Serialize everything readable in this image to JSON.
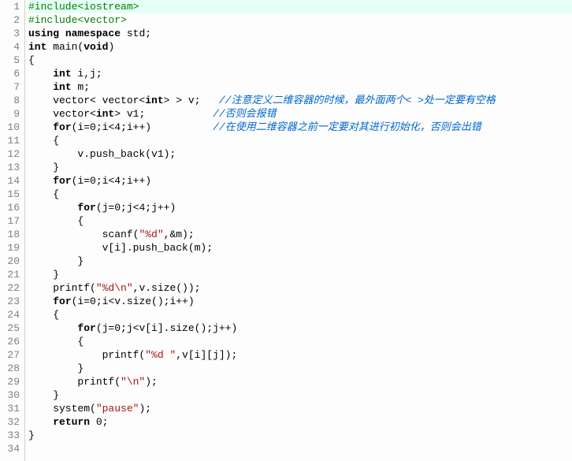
{
  "lines": [
    {
      "n": 1,
      "hl": true,
      "segs": [
        {
          "c": "pp",
          "t": "#include<iostream>"
        }
      ]
    },
    {
      "n": 2,
      "segs": [
        {
          "c": "pp",
          "t": "#include<vector>"
        }
      ]
    },
    {
      "n": 3,
      "segs": [
        {
          "c": "kw",
          "t": "using"
        },
        {
          "c": "txt",
          "t": " "
        },
        {
          "c": "kw",
          "t": "namespace"
        },
        {
          "c": "txt",
          "t": " std;"
        }
      ]
    },
    {
      "n": 4,
      "segs": [
        {
          "c": "kw",
          "t": "int"
        },
        {
          "c": "txt",
          "t": " main("
        },
        {
          "c": "kw",
          "t": "void"
        },
        {
          "c": "txt",
          "t": ")"
        }
      ]
    },
    {
      "n": 5,
      "segs": [
        {
          "c": "txt",
          "t": "{"
        }
      ]
    },
    {
      "n": 6,
      "segs": [
        {
          "c": "txt",
          "t": "    "
        },
        {
          "c": "kw",
          "t": "int"
        },
        {
          "c": "txt",
          "t": " i,j;"
        }
      ]
    },
    {
      "n": 7,
      "segs": [
        {
          "c": "txt",
          "t": "    "
        },
        {
          "c": "kw",
          "t": "int"
        },
        {
          "c": "txt",
          "t": " m;"
        }
      ]
    },
    {
      "n": 8,
      "segs": [
        {
          "c": "txt",
          "t": "    vector< vector<"
        },
        {
          "c": "kw",
          "t": "int"
        },
        {
          "c": "txt",
          "t": "> > v;   "
        },
        {
          "c": "cmt",
          "t": "//注意定义二维容器的时候，最外面两个< >处一定要有空格"
        }
      ]
    },
    {
      "n": 9,
      "segs": [
        {
          "c": "txt",
          "t": "    vector<"
        },
        {
          "c": "kw",
          "t": "int"
        },
        {
          "c": "txt",
          "t": "> v1;           "
        },
        {
          "c": "cmt",
          "t": "//否则会报错"
        }
      ]
    },
    {
      "n": 10,
      "segs": [
        {
          "c": "txt",
          "t": "    "
        },
        {
          "c": "kw",
          "t": "for"
        },
        {
          "c": "txt",
          "t": "(i="
        },
        {
          "c": "num",
          "t": "0"
        },
        {
          "c": "txt",
          "t": ";i<"
        },
        {
          "c": "num",
          "t": "4"
        },
        {
          "c": "txt",
          "t": ";i++)          "
        },
        {
          "c": "cmt",
          "t": "//在使用二维容器之前一定要对其进行初始化，否则会出错"
        }
      ]
    },
    {
      "n": 11,
      "segs": [
        {
          "c": "txt",
          "t": "    {"
        }
      ]
    },
    {
      "n": 12,
      "segs": [
        {
          "c": "txt",
          "t": "        v.push_back(v1);"
        }
      ]
    },
    {
      "n": 13,
      "segs": [
        {
          "c": "txt",
          "t": "    }"
        }
      ]
    },
    {
      "n": 14,
      "segs": [
        {
          "c": "txt",
          "t": "    "
        },
        {
          "c": "kw",
          "t": "for"
        },
        {
          "c": "txt",
          "t": "(i="
        },
        {
          "c": "num",
          "t": "0"
        },
        {
          "c": "txt",
          "t": ";i<"
        },
        {
          "c": "num",
          "t": "4"
        },
        {
          "c": "txt",
          "t": ";i++)"
        }
      ]
    },
    {
      "n": 15,
      "segs": [
        {
          "c": "txt",
          "t": "    {"
        }
      ]
    },
    {
      "n": 16,
      "segs": [
        {
          "c": "txt",
          "t": "        "
        },
        {
          "c": "kw",
          "t": "for"
        },
        {
          "c": "txt",
          "t": "(j="
        },
        {
          "c": "num",
          "t": "0"
        },
        {
          "c": "txt",
          "t": ";j<"
        },
        {
          "c": "num",
          "t": "4"
        },
        {
          "c": "txt",
          "t": ";j++)"
        }
      ]
    },
    {
      "n": 17,
      "segs": [
        {
          "c": "txt",
          "t": "        {"
        }
      ]
    },
    {
      "n": 18,
      "segs": [
        {
          "c": "txt",
          "t": "            scanf("
        },
        {
          "c": "str",
          "t": "\"%d\""
        },
        {
          "c": "txt",
          "t": ",&m);"
        }
      ]
    },
    {
      "n": 19,
      "segs": [
        {
          "c": "txt",
          "t": "            v[i].push_back(m);"
        }
      ]
    },
    {
      "n": 20,
      "segs": [
        {
          "c": "txt",
          "t": "        }"
        }
      ]
    },
    {
      "n": 21,
      "segs": [
        {
          "c": "txt",
          "t": "    }"
        }
      ]
    },
    {
      "n": 22,
      "segs": [
        {
          "c": "txt",
          "t": "    printf("
        },
        {
          "c": "str",
          "t": "\"%d\\n\""
        },
        {
          "c": "txt",
          "t": ",v.size());"
        }
      ]
    },
    {
      "n": 23,
      "segs": [
        {
          "c": "txt",
          "t": "    "
        },
        {
          "c": "kw",
          "t": "for"
        },
        {
          "c": "txt",
          "t": "(i="
        },
        {
          "c": "num",
          "t": "0"
        },
        {
          "c": "txt",
          "t": ";i<v.size();i++)"
        }
      ]
    },
    {
      "n": 24,
      "segs": [
        {
          "c": "txt",
          "t": "    {"
        }
      ]
    },
    {
      "n": 25,
      "segs": [
        {
          "c": "txt",
          "t": "        "
        },
        {
          "c": "kw",
          "t": "for"
        },
        {
          "c": "txt",
          "t": "(j="
        },
        {
          "c": "num",
          "t": "0"
        },
        {
          "c": "txt",
          "t": ";j<v[i].size();j++)"
        }
      ]
    },
    {
      "n": 26,
      "segs": [
        {
          "c": "txt",
          "t": "        {"
        }
      ]
    },
    {
      "n": 27,
      "segs": [
        {
          "c": "txt",
          "t": "            printf("
        },
        {
          "c": "str",
          "t": "\"%d \""
        },
        {
          "c": "txt",
          "t": ",v[i][j]);"
        }
      ]
    },
    {
      "n": 28,
      "segs": [
        {
          "c": "txt",
          "t": "        }"
        }
      ]
    },
    {
      "n": 29,
      "segs": [
        {
          "c": "txt",
          "t": "        printf("
        },
        {
          "c": "str",
          "t": "\"\\n\""
        },
        {
          "c": "txt",
          "t": ");"
        }
      ]
    },
    {
      "n": 30,
      "segs": [
        {
          "c": "txt",
          "t": "    }"
        }
      ]
    },
    {
      "n": 31,
      "segs": [
        {
          "c": "txt",
          "t": "    system("
        },
        {
          "c": "str",
          "t": "\"pause\""
        },
        {
          "c": "txt",
          "t": ");"
        }
      ]
    },
    {
      "n": 32,
      "segs": [
        {
          "c": "txt",
          "t": "    "
        },
        {
          "c": "kw",
          "t": "return"
        },
        {
          "c": "txt",
          "t": " "
        },
        {
          "c": "num",
          "t": "0"
        },
        {
          "c": "txt",
          "t": ";"
        }
      ]
    },
    {
      "n": 33,
      "segs": [
        {
          "c": "txt",
          "t": "}"
        }
      ]
    },
    {
      "n": 34,
      "segs": [
        {
          "c": "txt",
          "t": ""
        }
      ]
    }
  ]
}
